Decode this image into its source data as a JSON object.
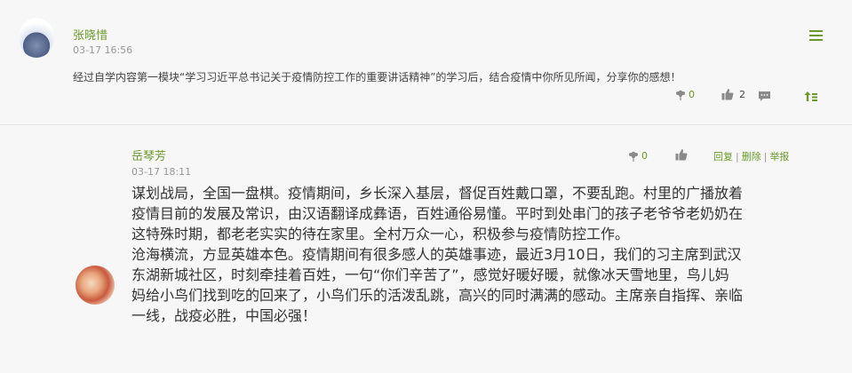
{
  "post": {
    "author": "张晓惜",
    "timestamp": "03-17 16:56",
    "text": "经过自学内容第一模块“学习习近平总书记关于疫情防控工作的重要讲话精神”的学习后，结合疫情中你所见所闻，分享你的感想！",
    "flower_count": "0",
    "like_count": "2",
    "icons": [
      "menu-icon",
      "flower-icon",
      "thumbs-up-icon",
      "comment-icon",
      "sort-up-icon"
    ]
  },
  "reply": {
    "author": "岳琴芳",
    "timestamp": "03-17 18:11",
    "flower_count": "0",
    "links": {
      "reply": "回复",
      "delete": "删除",
      "report": "举报",
      "separator": "|"
    },
    "lines": [
      "谋划战局，全国一盘棋。疫情期间，乡长深入基层，督促百姓戴口罩，不要乱跑。村里的广播放着",
      "疫情目前的发展及常识，由汉语翻译成彝语，百姓通俗易懂。平时到处串门的孩子老爷爷老奶奶在",
      "这特殊时期，都老老实实的待在家里。全村万众一心，积极参与疫情防控工作。",
      "沧海横流，方显英雄本色。疫情期间有很多感人的英雄事迹，最近3月10日，我们的习主席到武汉",
      "东湖新城社区，时刻牵挂着百姓，一句“你们辛苦了”，感觉好暖好暖，就像冰天雪地里，鸟儿妈",
      "妈给小鸟们找到吃的回来了，小鸟们乐的活泼乱跳，高兴的同时满满的感动。主席亲自指挥、亲临",
      "一线，战疫必胜，中国必强！"
    ]
  },
  "colors": {
    "accent": "#6b9a2a",
    "muted": "#999999",
    "background": "#f7f7f7"
  }
}
